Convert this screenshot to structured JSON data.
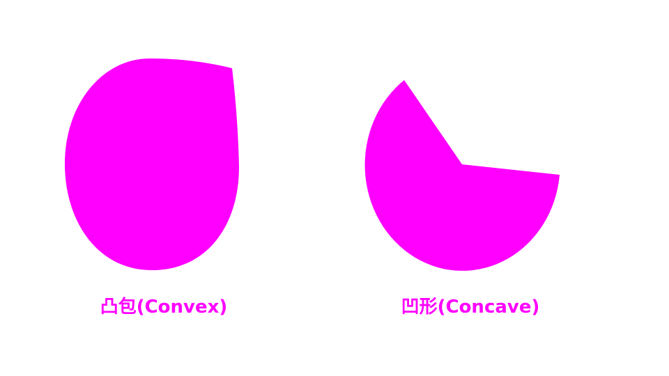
{
  "diagram": {
    "accent_color": "#ff00ff",
    "convex": {
      "label": "凸包(Convex)"
    },
    "concave": {
      "label": "凹形(Concave)"
    }
  }
}
